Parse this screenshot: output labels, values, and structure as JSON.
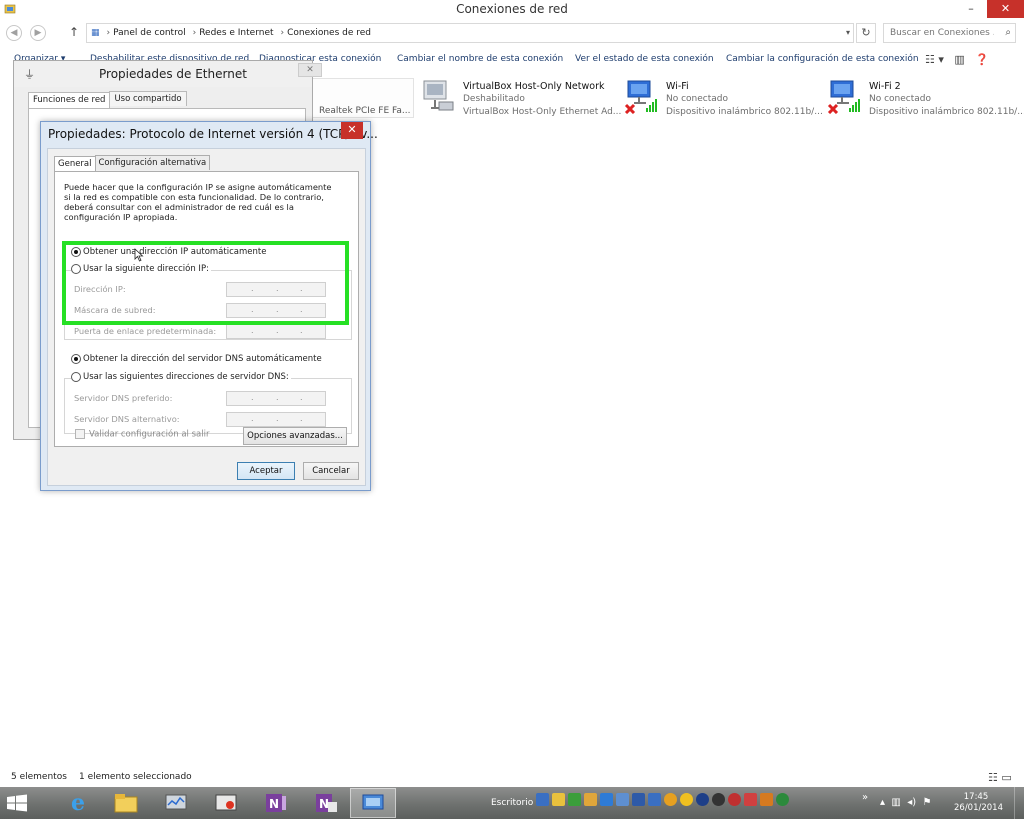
{
  "window": {
    "title": "Conexiones de red",
    "min_glyph": "–",
    "max_glyph": "❐",
    "close_glyph": "✕"
  },
  "address": {
    "crumbs": [
      "Panel de control",
      "Redes e Internet",
      "Conexiones de red"
    ],
    "search_placeholder": "Buscar en Conexiones ..."
  },
  "commandbar": {
    "organize": "Organizar ▾",
    "disable": "Deshabilitar este dispositivo de red",
    "diagnose": "Diagnosticar esta conexión",
    "rename": "Cambiar el nombre de esta conexión",
    "status": "Ver el estado de esta conexión",
    "change": "Cambiar la configuración de esta conexión"
  },
  "connections": [
    {
      "name": "VirtualBox Host-Only Network",
      "status": "Deshabilitado",
      "device": "VirtualBox Host-Only Ethernet Ad..."
    },
    {
      "name": "Wi-Fi",
      "status": "No conectado",
      "device": "Dispositivo inalámbrico 802.11b/..."
    },
    {
      "name": "Wi-Fi 2",
      "status": "No conectado",
      "device": "Dispositivo inalámbrico 802.11b/..."
    }
  ],
  "realtek_fragment": "Realtek PCIe FE Fa...",
  "statusbar": {
    "count": "5 elementos",
    "selected": "1 elemento seleccionado"
  },
  "ethernet_dialog": {
    "title": "Propiedades de Ethernet",
    "tabs": [
      "Funciones de red",
      "Uso compartido"
    ],
    "close_glyph": "✕"
  },
  "ipv4_dialog": {
    "title": "Propiedades: Protocolo de Internet versión 4 (TCP/IPv...",
    "close_glyph": "✕",
    "tabs": [
      "General",
      "Configuración alternativa"
    ],
    "description": "Puede hacer que la configuración IP se asigne automáticamente si la red es compatible con esta funcionalidad. De lo contrario, deberá consultar con el administrador de red cuál es la configuración IP apropiada.",
    "ip_auto": "Obtener una dirección IP automáticamente",
    "ip_manual": "Usar la siguiente dirección IP:",
    "ip_address_label": "Dirección IP:",
    "subnet_label": "Máscara de subred:",
    "gateway_label": "Puerta de enlace predeterminada:",
    "dns_auto": "Obtener la dirección del servidor DNS automáticamente",
    "dns_manual": "Usar las siguientes direcciones de servidor DNS:",
    "dns_preferred_label": "Servidor DNS preferido:",
    "dns_alternate_label": "Servidor DNS alternativo:",
    "validate": "Validar configuración al salir",
    "advanced": "Opciones avanzadas...",
    "ok": "Aceptar",
    "cancel": "Cancelar",
    "highlight_color": "#26e024"
  },
  "taskbar": {
    "desktop_label": "Escritorio",
    "time": "17:45",
    "date": "26/01/2014",
    "chevron": "»"
  }
}
